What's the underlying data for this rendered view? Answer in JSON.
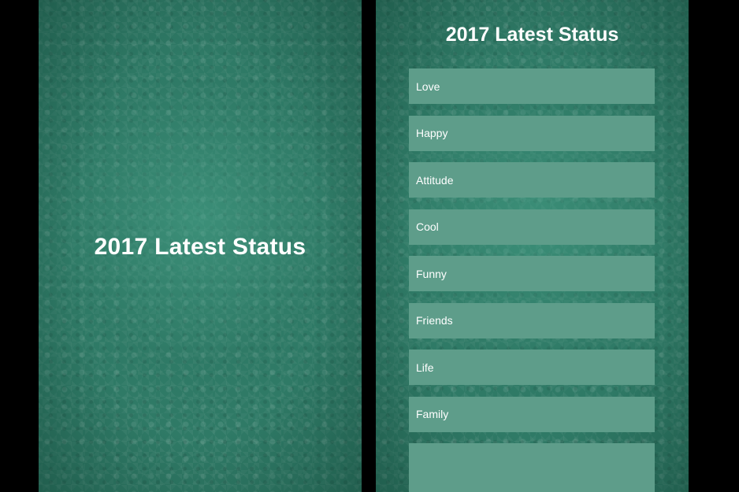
{
  "splash": {
    "title": "2017 Latest Status"
  },
  "list_screen": {
    "title": "2017 Latest Status",
    "items": [
      {
        "label": "Love"
      },
      {
        "label": "Happy"
      },
      {
        "label": "Attitude"
      },
      {
        "label": "Cool"
      },
      {
        "label": "Funny"
      },
      {
        "label": "Friends"
      },
      {
        "label": "Life"
      },
      {
        "label": "Family"
      },
      {
        "label": ""
      }
    ]
  },
  "colors": {
    "background_green": "#2f7a66",
    "item_background": "#5e9d8a",
    "text": "#ffffff",
    "letterbox": "#000000"
  }
}
